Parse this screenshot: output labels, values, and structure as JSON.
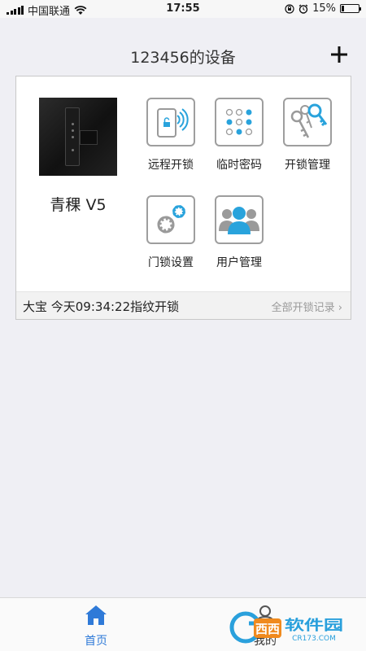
{
  "status_bar": {
    "carrier": "中国联通",
    "time": "17:55",
    "battery": "15%",
    "battery_level": 0.15
  },
  "header": {
    "title": "123456的设备"
  },
  "device": {
    "name": "青稞 V5",
    "functions": [
      {
        "label": "远程开锁",
        "icon": "remote-unlock-icon"
      },
      {
        "label": "临时密码",
        "icon": "temp-password-icon"
      },
      {
        "label": "开锁管理",
        "icon": "keys-icon"
      },
      {
        "label": "门锁设置",
        "icon": "gear-icon"
      },
      {
        "label": "用户管理",
        "icon": "users-icon"
      }
    ],
    "last_unlock": "大宝  今天09:34:22指纹开锁",
    "all_records": "全部开锁记录 ›"
  },
  "tabs": [
    {
      "label": "首页",
      "active": true,
      "icon": "home-icon"
    },
    {
      "label": "我的",
      "active": false,
      "icon": "person-icon"
    }
  ],
  "watermark": {
    "text": "西西软件园",
    "sub": "CR173.COM"
  },
  "colors": {
    "accent": "#2f7ad8",
    "icon_blue": "#29a3dc",
    "icon_gray": "#9a9a9a"
  }
}
